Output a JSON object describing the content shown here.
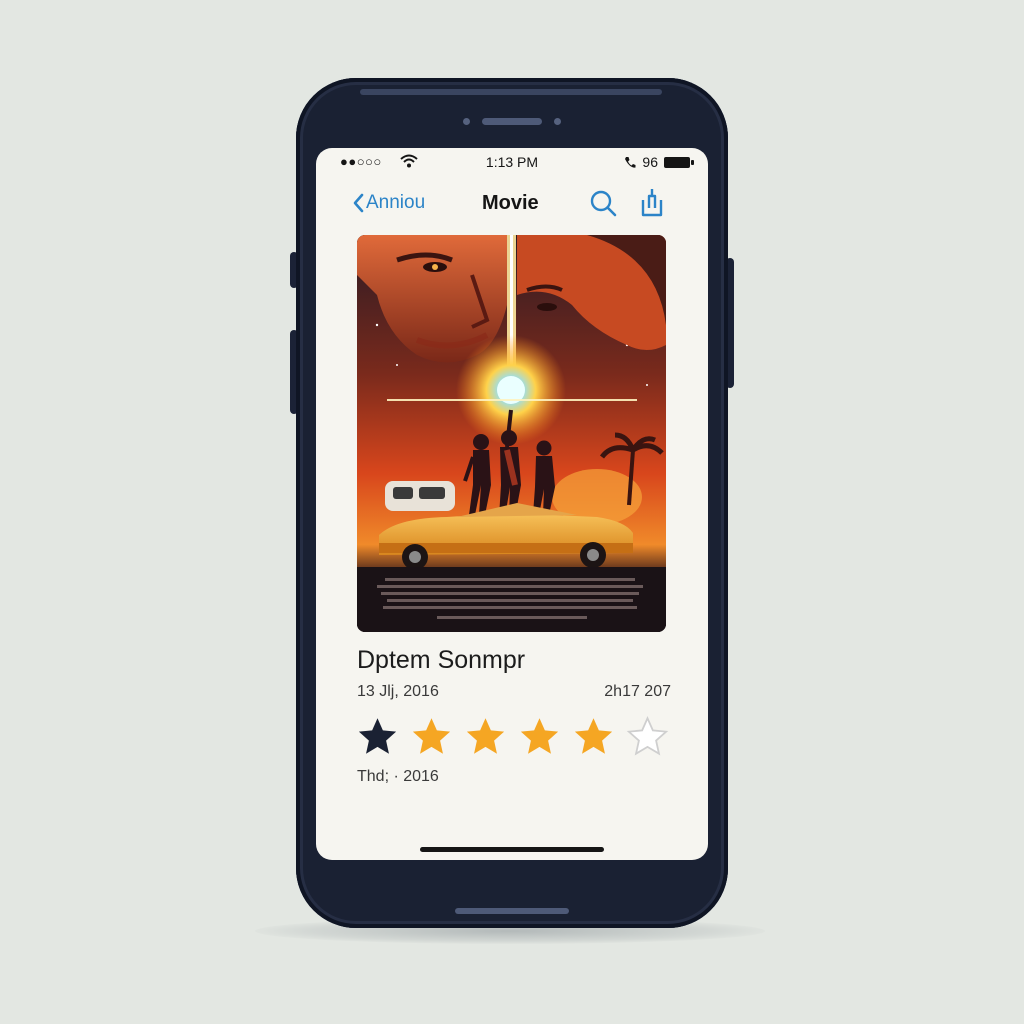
{
  "status_bar": {
    "signal": "●●○○○",
    "time": "1:13 PM",
    "battery_percent": "96"
  },
  "nav": {
    "back_label": "Anniou",
    "title": "Movie",
    "search_icon": "search-icon",
    "share_icon": "share-icon"
  },
  "movie": {
    "title": "Dptem Sonmpr",
    "release_date": "13 Jlj, 2016",
    "runtime": "2h17 207",
    "rating": {
      "value": 5,
      "max": 6,
      "first_star_style": "dark"
    },
    "meta_line": "Thd; · 2016"
  },
  "colors": {
    "accent": "#2c84c8",
    "star_filled": "#f5a623",
    "star_dark": "#1a2133",
    "phone_body": "#1a2133"
  }
}
